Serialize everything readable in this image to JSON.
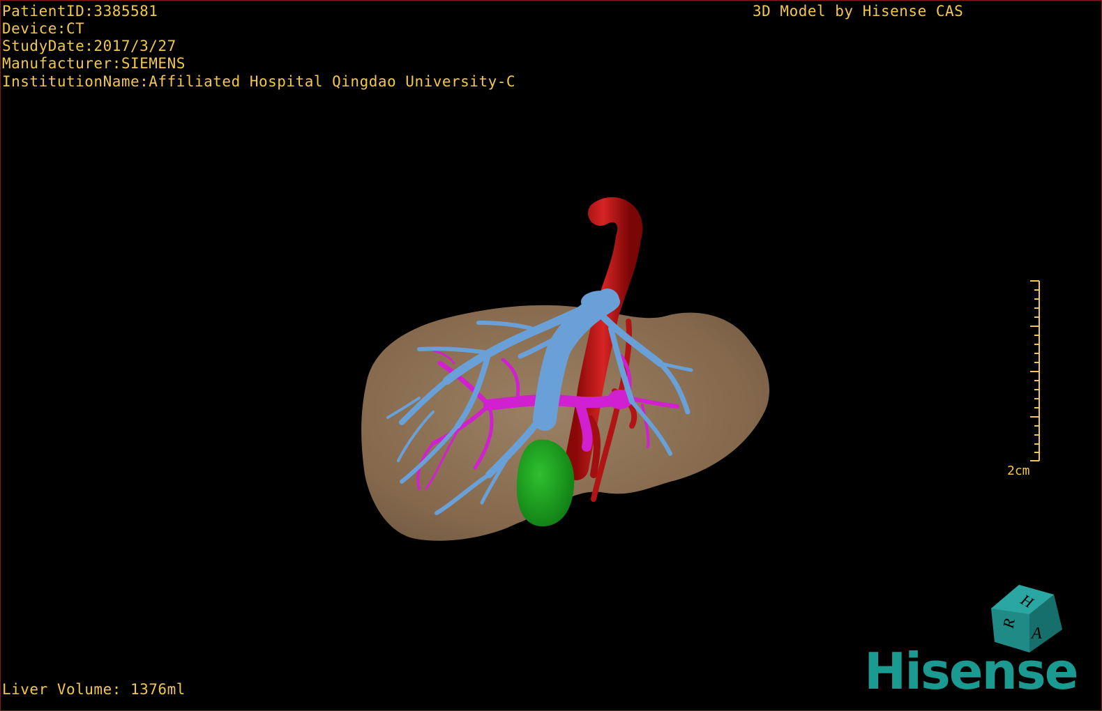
{
  "patient_info": {
    "patient_id": "PatientID:3385581",
    "device": "Device:CT",
    "study_date": "StudyDate:2017/3/27",
    "manufacturer": "Manufacturer:SIEMENS",
    "institution": "InstitutionName:Affiliated Hospital Qingdao University-C"
  },
  "model_credit": "3D Model by Hisense CAS",
  "scale_bar": {
    "label": "2cm"
  },
  "footer": {
    "liver_volume": "Liver Volume: 1376ml"
  },
  "orientation_cube": {
    "faces": [
      "H",
      "R",
      "A"
    ],
    "icon": "orientation-cube-icon"
  },
  "brand": {
    "name": "Hisense"
  },
  "colors": {
    "overlay_text": "#f2c84b",
    "liver": "#8b7355",
    "portal_vein": "#6aa0d8",
    "hepatic_artery": "#c41a1a",
    "hepatic_vein": "#d020d0",
    "gallbladder": "#1fa01f",
    "brand": "#1a9a90"
  }
}
